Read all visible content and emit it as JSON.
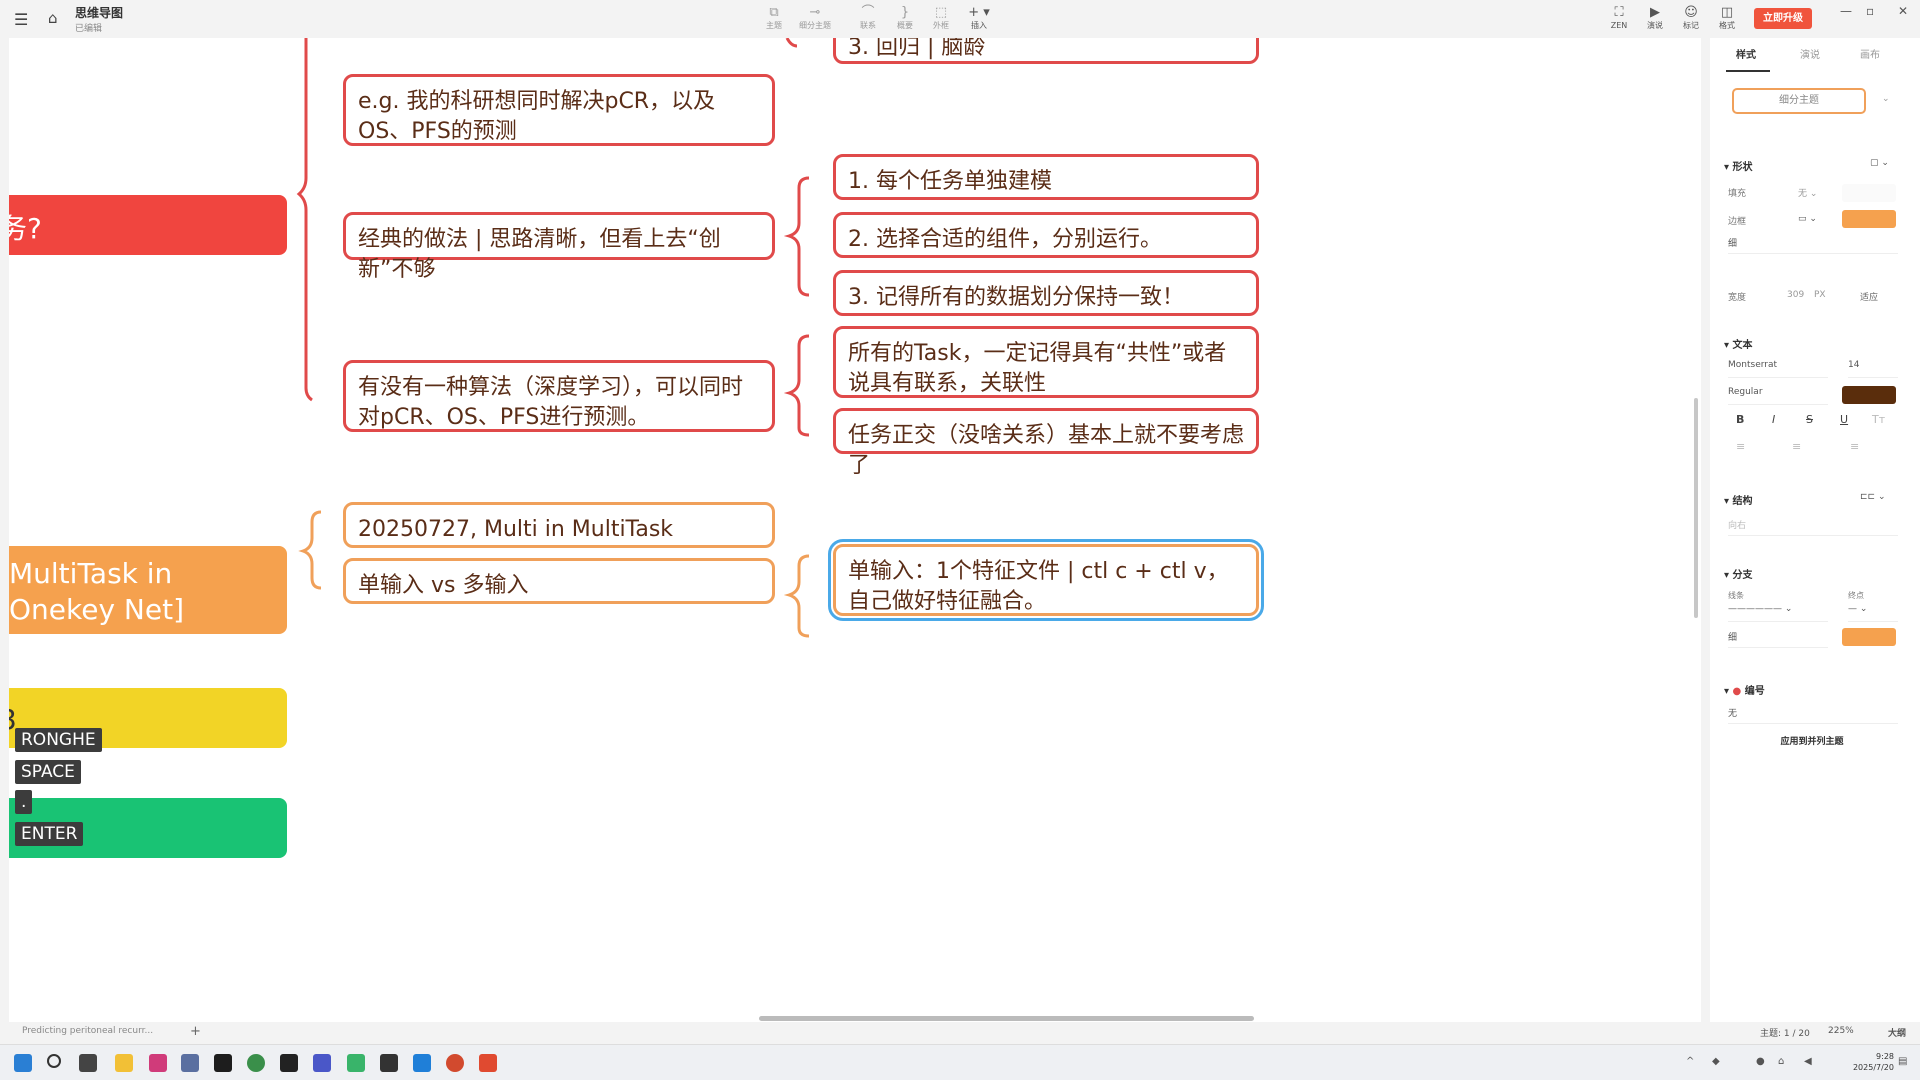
{
  "app": {
    "title": "思维导图",
    "subtitle": "已编辑",
    "upgrade_label": "立即升级"
  },
  "toolbar": {
    "items": [
      {
        "label": "主题",
        "icon": "topic-icon"
      },
      {
        "label": "细分主题",
        "icon": "subtopic-icon"
      },
      {
        "label": "联系",
        "icon": "relation-icon"
      },
      {
        "label": "概要",
        "icon": "summary-icon"
      },
      {
        "label": "外框",
        "icon": "boundary-icon"
      },
      {
        "label": "插入",
        "icon": "insert-icon"
      }
    ],
    "right": [
      {
        "label": "ZEN",
        "icon": "fullscreen-icon"
      },
      {
        "label": "演说",
        "icon": "present-icon"
      },
      {
        "label": "标记",
        "icon": "marker-icon"
      },
      {
        "label": "格式",
        "icon": "format-panel-icon"
      }
    ]
  },
  "mindmap": {
    "main_topics": [
      {
        "text": "务?",
        "color": "#f0453f"
      },
      {
        "text": "MultiTask in Onekey Net]",
        "color": "#f5a14e"
      },
      {
        "text": "3",
        "color": "#f2d426"
      },
      {
        "text": "",
        "color": "#19c374"
      }
    ],
    "middle": [
      "e.g. 我的科研想同时解决pCR，以及OS、PFS的预测",
      "经典的做法 | 思路清晰，但看上去“创新”不够",
      "有没有一种算法（深度学习），可以同时对pCR、OS、PFS进行预测。",
      "20250727, Multi in MultiTask",
      "单输入 vs 多输入"
    ],
    "right": [
      "3. 回归 | 脑龄",
      "1. 每个任务单独建模",
      "2. 选择合适的组件，分别运行。",
      "3. 记得所有的数据划分保持一致！",
      "所有的Task，一定记得具有“共性”或者说具有联系，关联性",
      "任务正交（没啥关系）基本上就不要考虑了",
      "单输入：1个特征文件 | ctl c + ctl v，自己做好特征融合。"
    ]
  },
  "keys": [
    "RONGHE",
    "SPACE",
    ".",
    "ENTER"
  ],
  "panel": {
    "tabs": [
      "样式",
      "演说",
      "画布"
    ],
    "subtopic_button": "细分主题",
    "shape": {
      "section": "形状",
      "fill_label": "填充",
      "fill_value": "无",
      "border_label": "边框",
      "border_color": "#f5a14e",
      "border_weight": "细",
      "width_label": "宽度",
      "width_value": "309",
      "width_unit": "PX",
      "fit_label": "适应"
    },
    "text": {
      "section": "文本",
      "font": "Montserrat",
      "size": "14",
      "weight": "Regular",
      "color": "#5a2d0c"
    },
    "structure": {
      "section": "结构",
      "value": "向右"
    },
    "branch": {
      "section": "分支",
      "line_label": "线条",
      "end_label": "终点",
      "weight": "细",
      "color": "#f5a14e"
    },
    "numbering": {
      "section": "编号",
      "value": "无"
    },
    "apply_label": "应用到并列主题"
  },
  "status": {
    "topic_count": "主题: 1 / 20",
    "zoom": "225%",
    "outline": "大纲",
    "doc_tab": "Predicting peritoneal recurr..."
  },
  "taskbar": {
    "time": "9:28",
    "date": "2025/7/20"
  }
}
